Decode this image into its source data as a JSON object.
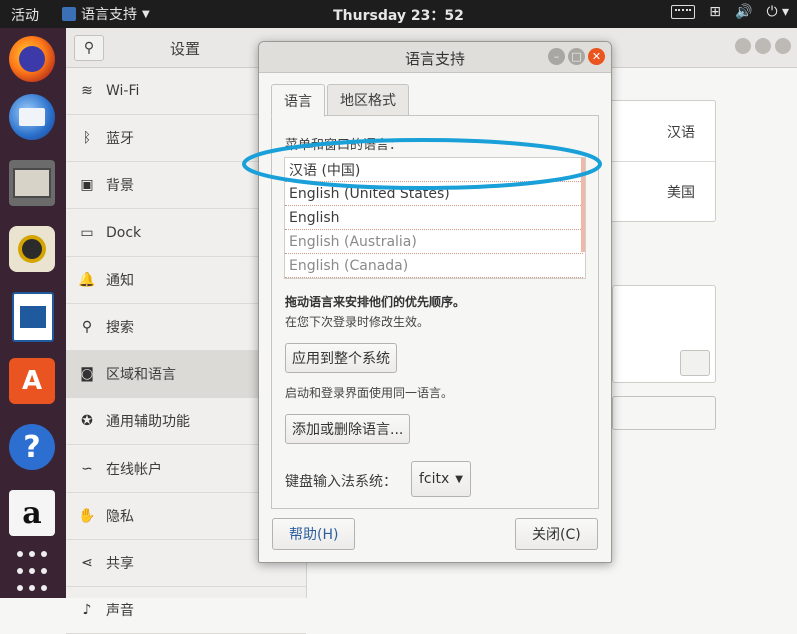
{
  "topbar": {
    "activities": "活动",
    "app_menu_label": "语言支持",
    "clock": "Thursday 23：52"
  },
  "dock": {
    "icons": [
      "firefox-icon",
      "thunderbird-icon",
      "files-icon",
      "rhythmbox-icon",
      "writer-icon",
      "software-icon",
      "help-icon",
      "amazon-icon",
      "apps-grid-icon"
    ]
  },
  "settings": {
    "title": "设置",
    "sidebar": {
      "items": [
        {
          "label": "Wi-Fi",
          "icon": "wifi-icon",
          "glyph": "≋"
        },
        {
          "label": "蓝牙",
          "icon": "bluetooth-icon",
          "glyph": "ᛒ"
        },
        {
          "label": "背景",
          "icon": "background-icon",
          "glyph": "▣"
        },
        {
          "label": "Dock",
          "icon": "dock-icon",
          "glyph": "▭"
        },
        {
          "label": "通知",
          "icon": "bell-icon",
          "glyph": "🔔"
        },
        {
          "label": "搜索",
          "icon": "search-icon",
          "glyph": "⚲"
        },
        {
          "label": "区域和语言",
          "icon": "region-icon",
          "glyph": "◙"
        },
        {
          "label": "通用辅助功能",
          "icon": "accessibility-icon",
          "glyph": "✪"
        },
        {
          "label": "在线帐户",
          "icon": "online-accounts-icon",
          "glyph": "∽"
        },
        {
          "label": "隐私",
          "icon": "privacy-icon",
          "glyph": "✋"
        },
        {
          "label": "共享",
          "icon": "share-icon",
          "glyph": "⋖"
        },
        {
          "label": "声音",
          "icon": "sound-icon",
          "glyph": "♪"
        }
      ],
      "active_index": 6
    },
    "content": {
      "language_value": "汉语",
      "formats_value": "美国"
    }
  },
  "dialog": {
    "title": "语言支持",
    "tabs": [
      "语言",
      "地区格式"
    ],
    "list_label": "菜单和窗口的语言：",
    "languages": [
      {
        "label": "汉语 (中国)",
        "dim": false
      },
      {
        "label": "English (United States)",
        "dim": false
      },
      {
        "label": "English",
        "dim": false
      },
      {
        "label": "English (Australia)",
        "dim": true
      },
      {
        "label": "English (Canada)",
        "dim": true
      }
    ],
    "drag_hint": "拖动语言来安排他们的优先顺序。",
    "effect_hint": "在您下次登录时修改生效。",
    "apply_button": "应用到整个系统",
    "login_hint": "启动和登录界面使用同一语言。",
    "add_remove_button": "添加或删除语言...",
    "im_label": "键盘输入法系统：",
    "im_value": "fcitx",
    "help_button": "帮助(H)",
    "close_button": "关闭(C)"
  },
  "colors": {
    "annotation": "#1aa0d8",
    "accent": "#e95420"
  }
}
